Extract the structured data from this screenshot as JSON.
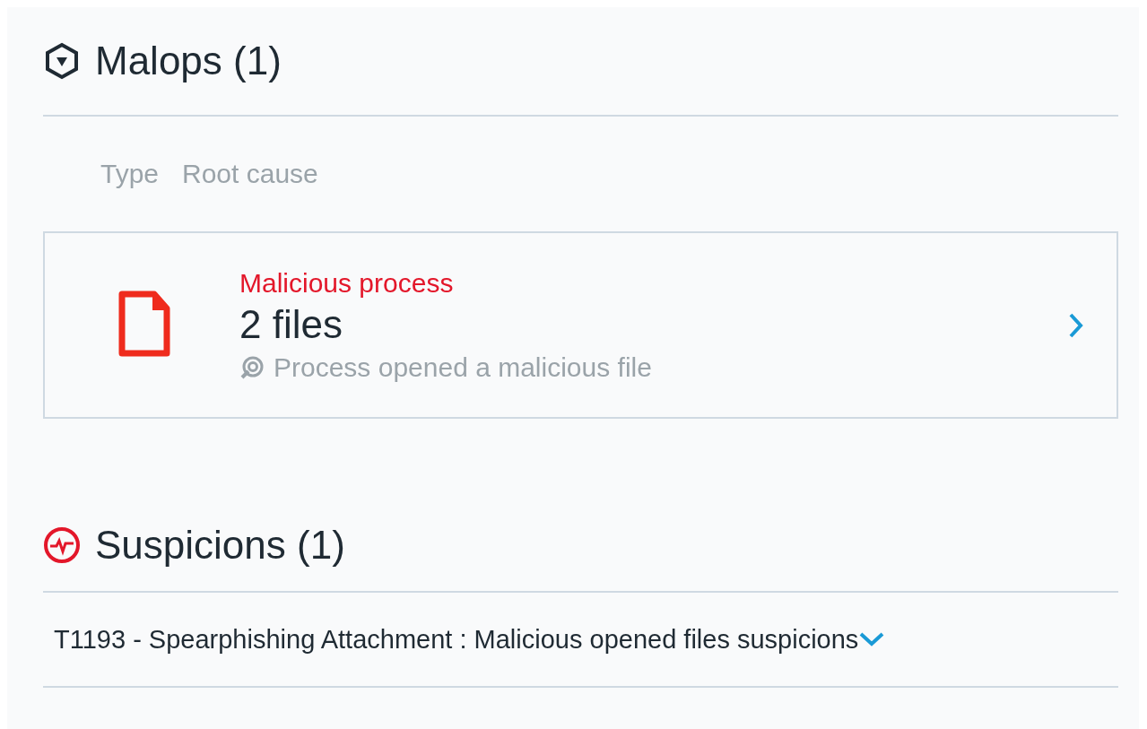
{
  "malops": {
    "title": "Malops (1)",
    "columns": [
      "Type",
      "Root cause"
    ],
    "items": [
      {
        "kind": "file",
        "category": "Malicious process",
        "root_cause": "2 files",
        "description": "Process opened a malicious file"
      }
    ]
  },
  "suspicions": {
    "title": "Suspicions (1)",
    "items": [
      {
        "label": "T1193 - Spearphishing Attachment : Malicious opened files suspicions",
        "expanded": false
      }
    ]
  }
}
